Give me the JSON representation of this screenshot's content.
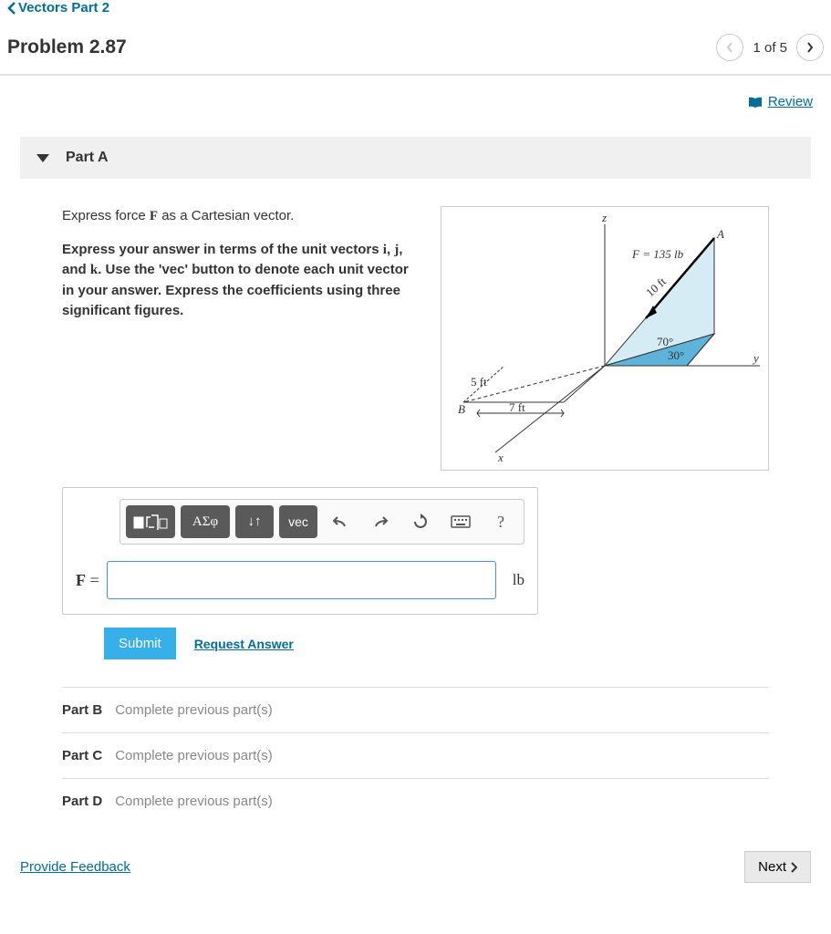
{
  "breadcrumb": {
    "label": "Vectors Part 2"
  },
  "header": {
    "title": "Problem 2.87",
    "page_count": "1 of 5"
  },
  "review": {
    "label": " Review"
  },
  "partA": {
    "label": "Part A",
    "line1_pre": "Express force ",
    "line1_F": "F",
    "line1_post": " as a Cartesian vector.",
    "instr_pre": "Express your answer in terms of the unit vectors ",
    "i": "i",
    "comma1": ", ",
    "j": "j",
    "comma2": ", and ",
    "k": "k",
    "instr_post": ". Use the 'vec' button to denote each unit vector in your answer. Express the coefficients using three significant figures.",
    "eq_F": "F",
    "eq_equals": " = ",
    "unit": "lb",
    "submit": "Submit",
    "request": "Request Answer"
  },
  "figure": {
    "z": "z",
    "y": "y",
    "x": "x",
    "A": "A",
    "B": "B",
    "F_label": "F = 135 lb",
    "ten_ft": "10 ft",
    "seventy": "70°",
    "thirty": "30°",
    "five_ft": "5 ft",
    "seven_ft": "7 ft"
  },
  "toolbar": {
    "templates": "▮√▯",
    "symbols": "ΑΣφ",
    "subsup": "↓↑",
    "vec": "vec"
  },
  "partB": {
    "label": "Part B",
    "msg": "Complete previous part(s)"
  },
  "partC": {
    "label": "Part C",
    "msg": "Complete previous part(s)"
  },
  "partD": {
    "label": "Part D",
    "msg": "Complete previous part(s)"
  },
  "footer": {
    "feedback": "Provide Feedback",
    "next": "Next "
  }
}
